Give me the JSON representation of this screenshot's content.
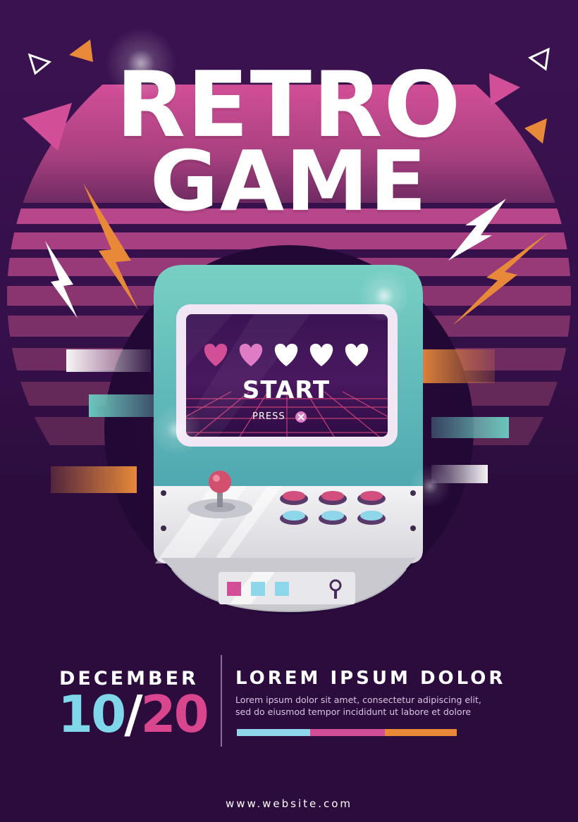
{
  "poster": {
    "title_line1": "RETRO",
    "title_line2": "GAME",
    "colors": {
      "background": "#2c0d3e",
      "sunset_pink": "#c64590",
      "cabinet_teal": "#6ac6bd",
      "accent_orange": "#e8893a",
      "accent_pink": "#d9468e",
      "accent_cyan": "#7ed8ea"
    }
  },
  "arcade_screen": {
    "start_label": "START",
    "press_label": "PRESS",
    "press_button_icon": "x-button-icon",
    "hearts_total": 5,
    "hearts_filled": 2
  },
  "event": {
    "month": "DECEMBER",
    "day_part1": "10",
    "slash": "/",
    "day_part2": "20",
    "headline": "LOREM IPSUM DOLOR",
    "body_line1": "Lorem ipsum dolor sit amet, consectetur adipiscing elit,",
    "body_line2": "sed do eiusmod tempor incididunt ut labore et dolore"
  },
  "footer": {
    "website": "www.website.com"
  }
}
